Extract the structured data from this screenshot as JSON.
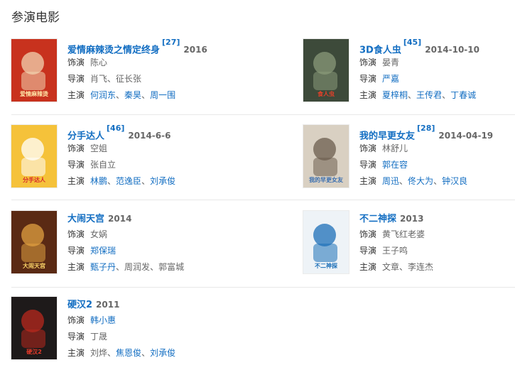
{
  "section_title": "参演电影",
  "labels": {
    "role": "饰演",
    "director": "导演",
    "cast": "主演"
  },
  "films": [
    {
      "title": "爱情麻辣烫之情定终身",
      "ref": "[27]",
      "date": "2016",
      "role": [
        {
          "text": "陈心",
          "link": false
        }
      ],
      "director": [
        {
          "text": "肖飞",
          "link": false
        },
        {
          "text": "征长张",
          "link": false
        }
      ],
      "cast": [
        {
          "text": "何润东",
          "link": true
        },
        {
          "text": "秦昊",
          "link": true
        },
        {
          "text": "周一围",
          "link": true
        }
      ],
      "poster": {
        "bg": "#c8321e",
        "accent": "#f2d3b0",
        "text": "爱情麻辣烫",
        "text_color": "#ffe6a8"
      }
    },
    {
      "title": "3D食人虫",
      "ref": "[45]",
      "date": "2014-10-10",
      "role": [
        {
          "text": "晏青",
          "link": false
        }
      ],
      "director": [
        {
          "text": "严嘉",
          "link": true
        }
      ],
      "cast": [
        {
          "text": "夏梓桐",
          "link": true
        },
        {
          "text": "王传君",
          "link": true
        },
        {
          "text": "丁春诚",
          "link": true
        }
      ],
      "poster": {
        "bg": "#3d4a3a",
        "accent": "#8a9a7a",
        "text": "食人虫",
        "text_color": "#e8402a"
      }
    },
    {
      "title": "分手达人",
      "ref": "[46]",
      "date": "2014-6-6",
      "role": [
        {
          "text": "空姐",
          "link": false
        }
      ],
      "director": [
        {
          "text": "张自立",
          "link": false
        }
      ],
      "cast": [
        {
          "text": "林鹏",
          "link": true
        },
        {
          "text": "范逸臣",
          "link": true
        },
        {
          "text": "刘承俊",
          "link": true
        }
      ],
      "poster": {
        "bg": "#f5c23a",
        "accent": "#ffffff",
        "text": "分手达人",
        "text_color": "#d8262a"
      }
    },
    {
      "title": "我的早更女友",
      "ref": "[28]",
      "date": "2014-04-19",
      "role": [
        {
          "text": "林舒儿",
          "link": false
        }
      ],
      "director": [
        {
          "text": "郭在容",
          "link": true
        }
      ],
      "cast": [
        {
          "text": "周迅",
          "link": true
        },
        {
          "text": "佟大为",
          "link": true
        },
        {
          "text": "钟汉良",
          "link": true
        }
      ],
      "poster": {
        "bg": "#d9d0c2",
        "accent": "#6b5d4e",
        "text": "我的早更女友",
        "text_color": "#3a6fb0"
      }
    },
    {
      "title": "大闹天宫",
      "ref": "",
      "date": "2014",
      "role": [
        {
          "text": "女娲",
          "link": false
        }
      ],
      "director": [
        {
          "text": "郑保瑞",
          "link": true
        }
      ],
      "cast": [
        {
          "text": "甄子丹",
          "link": true
        },
        {
          "text": "周润发",
          "link": false
        },
        {
          "text": "郭富城",
          "link": false
        }
      ],
      "poster": {
        "bg": "#5a2a14",
        "accent": "#e0a040",
        "text": "大闹天宫",
        "text_color": "#ffd86a"
      }
    },
    {
      "title": "不二神探",
      "ref": "",
      "date": "2013",
      "role": [
        {
          "text": "黄飞红老婆",
          "link": false
        }
      ],
      "director": [
        {
          "text": "王子鸣",
          "link": false
        }
      ],
      "cast": [
        {
          "text": "文章",
          "link": false
        },
        {
          "text": "李连杰",
          "link": false
        }
      ],
      "poster": {
        "bg": "#eef3f7",
        "accent": "#1c6fb8",
        "text": "不二神探",
        "text_color": "#1c6fb8"
      }
    },
    {
      "title": "硬汉2",
      "ref": "",
      "date": "2011",
      "role": [
        {
          "text": "韩小惠",
          "link": true
        }
      ],
      "director": [
        {
          "text": "丁晟",
          "link": false
        }
      ],
      "cast": [
        {
          "text": "刘烨",
          "link": false
        },
        {
          "text": "焦恩俊",
          "link": true
        },
        {
          "text": "刘承俊",
          "link": true
        }
      ],
      "poster": {
        "bg": "#1e1a1a",
        "accent": "#b8281e",
        "text": "硬汉2",
        "text_color": "#e83a2a"
      }
    }
  ]
}
